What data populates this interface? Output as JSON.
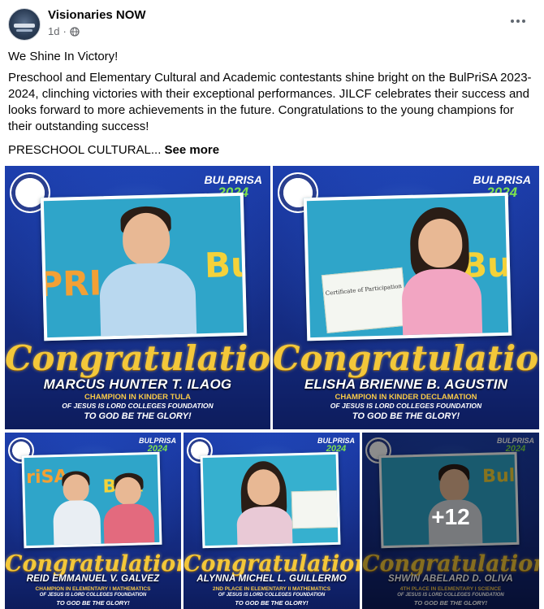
{
  "post": {
    "page_name": "Visionaries NOW",
    "time": "1d",
    "privacy_icon": "globe-icon",
    "more_icon": "more-options-icon",
    "headline": "We Shine In Victory!",
    "body": "Preschool and Elementary Cultural and Academic contestants shine bright on the BulPriSA 2023-2024, clinching victories with their exceptional performances. JILCF celebrates their success and looks forward to more achievements in the future. Congratulations to the young champions for their outstanding success!",
    "truncated": "PRESCHOOL CULTURAL...",
    "see_more": "See more"
  },
  "gallery": {
    "logo_line1": "BULPRISA",
    "logo_line2": "2024",
    "congrats": "Congratulations",
    "photos": [
      {
        "name": "MARCUS HUNTER T. ILAOG",
        "award": "CHAMPION IN KINDER TULA",
        "org": "OF JESUS IS LORD COLLEGES FOUNDATION",
        "glory": "TO GOD BE THE GLORY!"
      },
      {
        "name": "ELISHA BRIENNE B. AGUSTIN",
        "award": "CHAMPION IN KINDER DECLAMATION",
        "org": "OF JESUS IS LORD COLLEGES FOUNDATION",
        "glory": "TO GOD BE THE GLORY!",
        "certificate": "Certificate of Participation"
      },
      {
        "name": "REID EMMANUEL V. GALVEZ",
        "award": "CHAMPION IN ELEMENTARY I MATHEMATICS",
        "org": "OF JESUS IS LORD COLLEGES FOUNDATION",
        "glory": "TO GOD BE THE GLORY!"
      },
      {
        "name": "ALYNNA MICHEL L. GUILLERMO",
        "award": "2ND PLACE IN ELEMENTARY II MATHEMATICS",
        "org": "OF JESUS IS LORD COLLEGES FOUNDATION",
        "glory": "TO GOD BE THE GLORY!"
      },
      {
        "name": "SHWIN ABELARD D. OLIVA",
        "award": "4TH PLACE IN ELEMENTARY I SCIENCE",
        "org": "OF JESUS IS LORD COLLEGES FOUNDATION",
        "glory": "TO GOD BE THE GLORY!",
        "more_count": "+12"
      }
    ]
  },
  "colors": {
    "brand_blue": "#1d3fae",
    "gold": "#f3c73a",
    "green": "#7ee34f",
    "meta_gray": "#65676b"
  }
}
